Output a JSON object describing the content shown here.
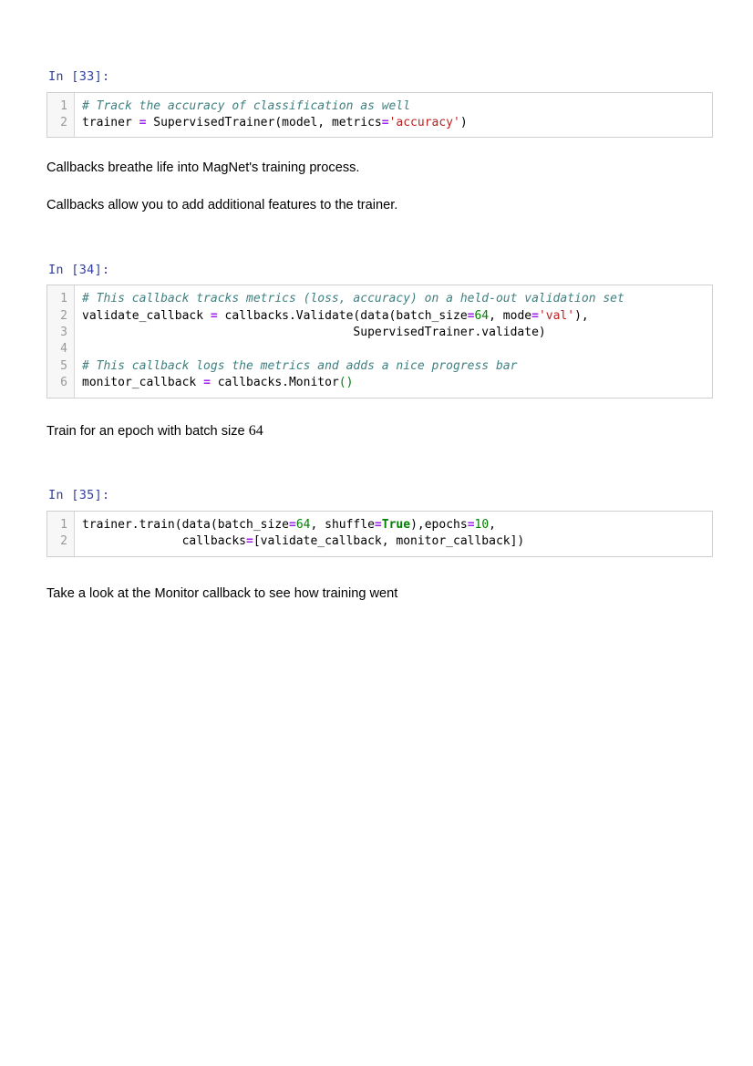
{
  "notebook": {
    "cells": [
      {
        "kind": "code",
        "name": "code-cell-33",
        "prompt": "In [33]:",
        "line_numbers": [
          "1",
          "2"
        ],
        "lines": [
          {
            "segments": [
              {
                "t": "# Track the accuracy of classification as well",
                "c": "tok-comment"
              }
            ]
          },
          {
            "segments": [
              {
                "t": "trainer ",
                "c": ""
              },
              {
                "t": "=",
                "c": "tok-op"
              },
              {
                "t": " SupervisedTrainer(model, metrics",
                "c": ""
              },
              {
                "t": "=",
                "c": "tok-op"
              },
              {
                "t": "'accuracy'",
                "c": "tok-str"
              },
              {
                "t": ")",
                "c": ""
              }
            ]
          }
        ]
      },
      {
        "kind": "markdown",
        "name": "markdown-callbacks-breathe",
        "text": "Callbacks breathe life into MagNet's training process."
      },
      {
        "kind": "markdown",
        "name": "markdown-callbacks-allow",
        "text": "Callbacks allow you to add additional features to the trainer."
      },
      {
        "kind": "code",
        "name": "code-cell-34",
        "prompt": "In [34]:",
        "line_numbers": [
          "1",
          "2",
          "3",
          "4",
          "5",
          "6"
        ],
        "lines": [
          {
            "segments": [
              {
                "t": "# This callback tracks metrics (loss, accuracy) on a held-out validation set",
                "c": "tok-comment"
              }
            ]
          },
          {
            "segments": [
              {
                "t": "validate_callback ",
                "c": ""
              },
              {
                "t": "=",
                "c": "tok-op"
              },
              {
                "t": " callbacks.Validate(data(batch_size",
                "c": ""
              },
              {
                "t": "=",
                "c": "tok-op"
              },
              {
                "t": "64",
                "c": "tok-num"
              },
              {
                "t": ", mode",
                "c": ""
              },
              {
                "t": "=",
                "c": "tok-op"
              },
              {
                "t": "'val'",
                "c": "tok-str"
              },
              {
                "t": "),",
                "c": ""
              }
            ]
          },
          {
            "segments": [
              {
                "t": "                                      SupervisedTrainer.validate)",
                "c": ""
              }
            ]
          },
          {
            "segments": [
              {
                "t": "",
                "c": ""
              }
            ]
          },
          {
            "segments": [
              {
                "t": "# This callback logs the metrics and adds a nice progress bar",
                "c": "tok-comment"
              }
            ]
          },
          {
            "segments": [
              {
                "t": "monitor_callback ",
                "c": ""
              },
              {
                "t": "=",
                "c": "tok-op"
              },
              {
                "t": " callbacks.Monitor",
                "c": ""
              },
              {
                "t": "()",
                "c": "tok-paren"
              }
            ]
          }
        ]
      },
      {
        "kind": "markdown-math",
        "name": "markdown-train-epoch",
        "text_before": "Train for an epoch with batch size ",
        "math": "64",
        "text_after": ""
      },
      {
        "kind": "code",
        "name": "code-cell-35",
        "prompt": "In [35]:",
        "line_numbers": [
          "1",
          "2"
        ],
        "lines": [
          {
            "segments": [
              {
                "t": "trainer.train(data(batch_size",
                "c": ""
              },
              {
                "t": "=",
                "c": "tok-op"
              },
              {
                "t": "64",
                "c": "tok-num"
              },
              {
                "t": ", shuffle",
                "c": ""
              },
              {
                "t": "=",
                "c": "tok-op"
              },
              {
                "t": "True",
                "c": "tok-kw"
              },
              {
                "t": "),epochs",
                "c": ""
              },
              {
                "t": "=",
                "c": "tok-op"
              },
              {
                "t": "10",
                "c": "tok-num"
              },
              {
                "t": ",",
                "c": ""
              }
            ]
          },
          {
            "segments": [
              {
                "t": "              callbacks",
                "c": ""
              },
              {
                "t": "=",
                "c": "tok-op"
              },
              {
                "t": "[validate_callback, monitor_callback])",
                "c": ""
              }
            ]
          }
        ]
      },
      {
        "kind": "markdown",
        "name": "markdown-take-a-look",
        "text": "Take a look at the Monitor callback to see how training went"
      }
    ]
  }
}
